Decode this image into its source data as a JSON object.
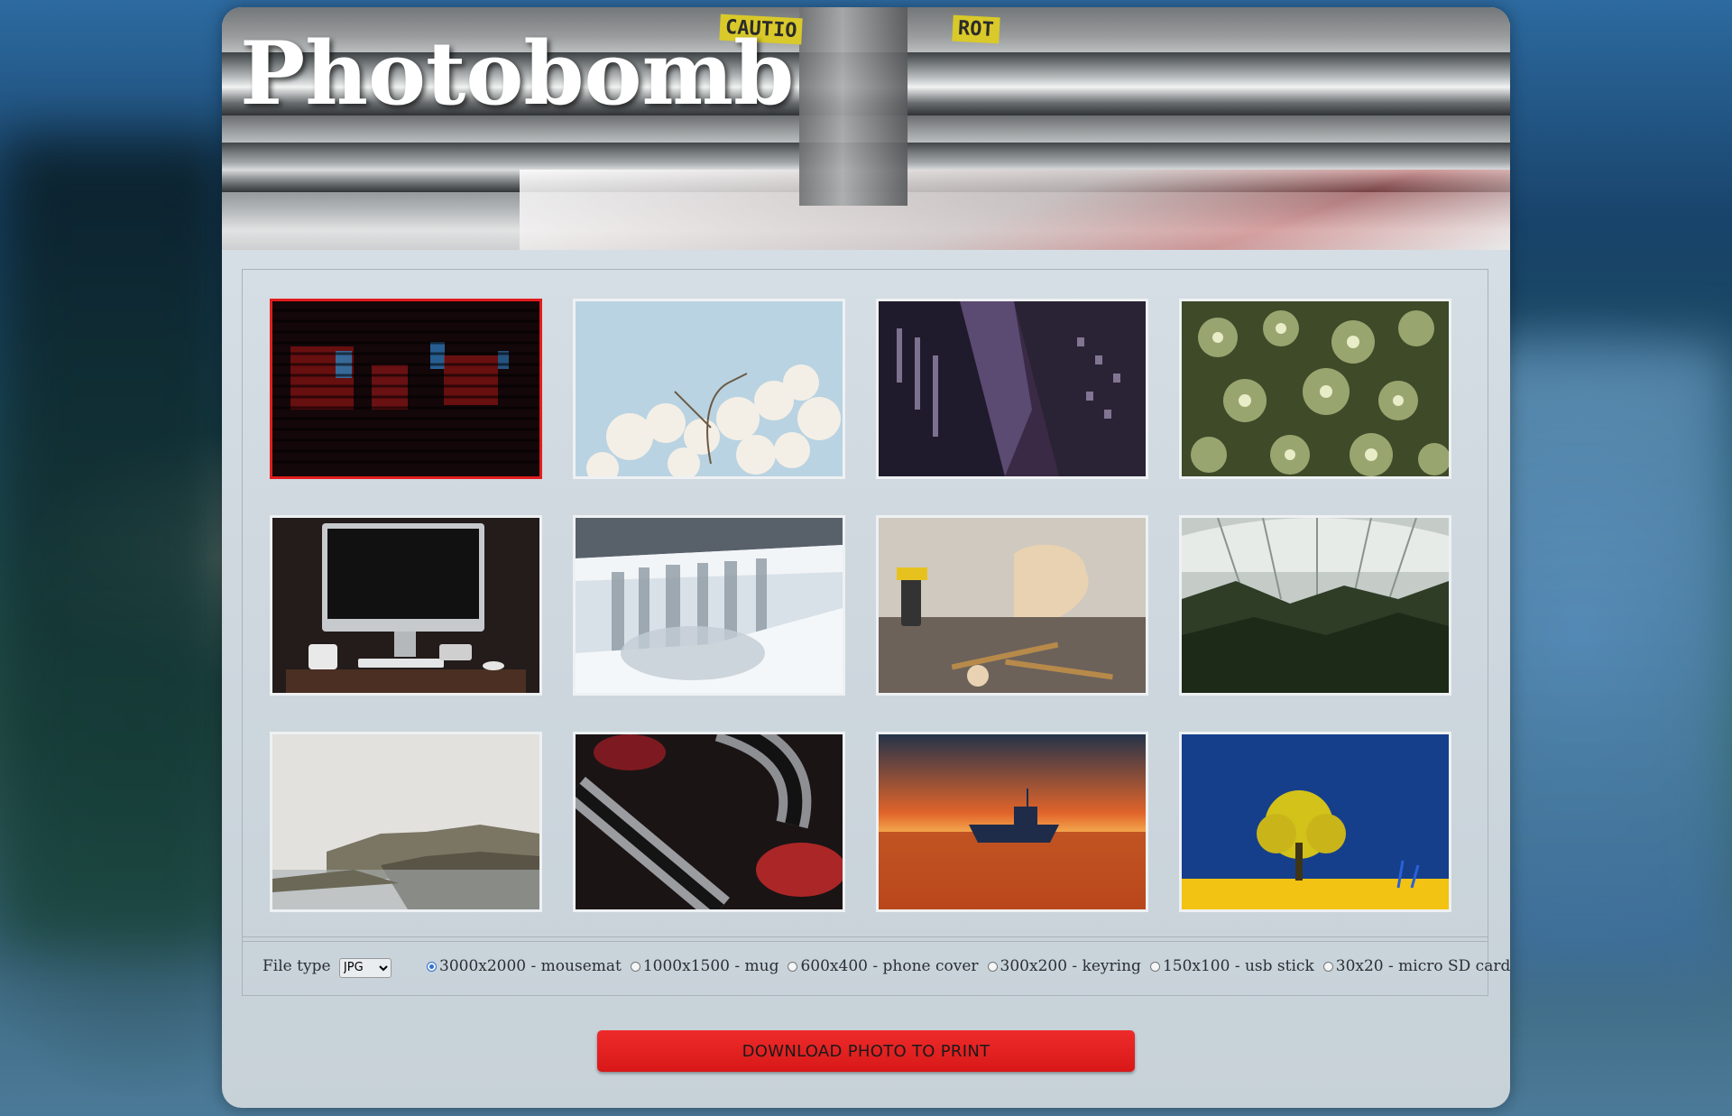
{
  "app": {
    "title": "Photobomb"
  },
  "gallery": {
    "photos": [
      {
        "subject": "dark red neon blinds",
        "selected": true
      },
      {
        "subject": "white magnolia blossoms",
        "selected": false
      },
      {
        "subject": "skyscrapers from below",
        "selected": false
      },
      {
        "subject": "green succulent plants",
        "selected": false
      },
      {
        "subject": "desktop computer on desk",
        "selected": false
      },
      {
        "subject": "frozen waterfall",
        "selected": false
      },
      {
        "subject": "woodworking tools",
        "selected": false
      },
      {
        "subject": "glass greenhouse",
        "selected": false
      },
      {
        "subject": "misty rocky coastline",
        "selected": false
      },
      {
        "subject": "abstract red chrome shapes",
        "selected": false
      },
      {
        "subject": "boat at sunset",
        "selected": false
      },
      {
        "subject": "yellow tree on blue sky",
        "selected": false
      }
    ]
  },
  "controls": {
    "file_type_label": "File type",
    "file_type_value": "JPG",
    "sizes": [
      {
        "label": "3000x2000 - mousemat",
        "checked": true
      },
      {
        "label": "1000x1500 - mug",
        "checked": false
      },
      {
        "label": "600x400 - phone cover",
        "checked": false
      },
      {
        "label": "300x200 - keyring",
        "checked": false
      },
      {
        "label": "150x100 - usb stick",
        "checked": false
      },
      {
        "label": "30x20 - micro SD card",
        "checked": false
      }
    ],
    "download_label": "DOWNLOAD PHOTO TO PRINT"
  },
  "colors": {
    "accent": "#e11d1d",
    "selected_radio": "#2f6fd6"
  }
}
